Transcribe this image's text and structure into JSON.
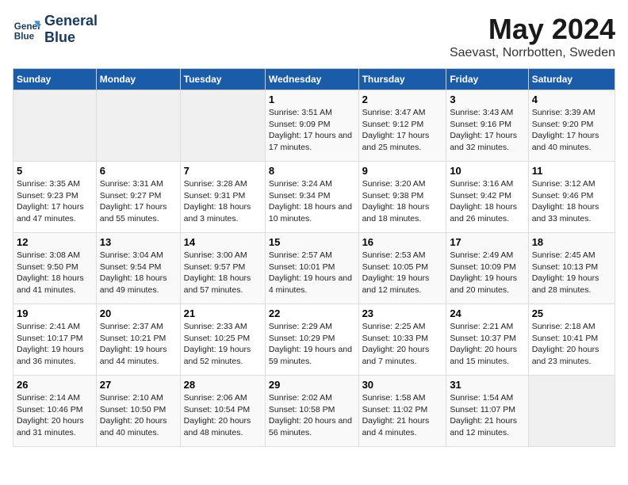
{
  "logo": {
    "line1": "General",
    "line2": "Blue"
  },
  "title": "May 2024",
  "subtitle": "Saevast, Norrbotten, Sweden",
  "days_header": [
    "Sunday",
    "Monday",
    "Tuesday",
    "Wednesday",
    "Thursday",
    "Friday",
    "Saturday"
  ],
  "weeks": [
    [
      {
        "num": "",
        "sunrise": "",
        "sunset": "",
        "daylight": ""
      },
      {
        "num": "",
        "sunrise": "",
        "sunset": "",
        "daylight": ""
      },
      {
        "num": "",
        "sunrise": "",
        "sunset": "",
        "daylight": ""
      },
      {
        "num": "1",
        "sunrise": "Sunrise: 3:51 AM",
        "sunset": "Sunset: 9:09 PM",
        "daylight": "Daylight: 17 hours and 17 minutes."
      },
      {
        "num": "2",
        "sunrise": "Sunrise: 3:47 AM",
        "sunset": "Sunset: 9:12 PM",
        "daylight": "Daylight: 17 hours and 25 minutes."
      },
      {
        "num": "3",
        "sunrise": "Sunrise: 3:43 AM",
        "sunset": "Sunset: 9:16 PM",
        "daylight": "Daylight: 17 hours and 32 minutes."
      },
      {
        "num": "4",
        "sunrise": "Sunrise: 3:39 AM",
        "sunset": "Sunset: 9:20 PM",
        "daylight": "Daylight: 17 hours and 40 minutes."
      }
    ],
    [
      {
        "num": "5",
        "sunrise": "Sunrise: 3:35 AM",
        "sunset": "Sunset: 9:23 PM",
        "daylight": "Daylight: 17 hours and 47 minutes."
      },
      {
        "num": "6",
        "sunrise": "Sunrise: 3:31 AM",
        "sunset": "Sunset: 9:27 PM",
        "daylight": "Daylight: 17 hours and 55 minutes."
      },
      {
        "num": "7",
        "sunrise": "Sunrise: 3:28 AM",
        "sunset": "Sunset: 9:31 PM",
        "daylight": "Daylight: 18 hours and 3 minutes."
      },
      {
        "num": "8",
        "sunrise": "Sunrise: 3:24 AM",
        "sunset": "Sunset: 9:34 PM",
        "daylight": "Daylight: 18 hours and 10 minutes."
      },
      {
        "num": "9",
        "sunrise": "Sunrise: 3:20 AM",
        "sunset": "Sunset: 9:38 PM",
        "daylight": "Daylight: 18 hours and 18 minutes."
      },
      {
        "num": "10",
        "sunrise": "Sunrise: 3:16 AM",
        "sunset": "Sunset: 9:42 PM",
        "daylight": "Daylight: 18 hours and 26 minutes."
      },
      {
        "num": "11",
        "sunrise": "Sunrise: 3:12 AM",
        "sunset": "Sunset: 9:46 PM",
        "daylight": "Daylight: 18 hours and 33 minutes."
      }
    ],
    [
      {
        "num": "12",
        "sunrise": "Sunrise: 3:08 AM",
        "sunset": "Sunset: 9:50 PM",
        "daylight": "Daylight: 18 hours and 41 minutes."
      },
      {
        "num": "13",
        "sunrise": "Sunrise: 3:04 AM",
        "sunset": "Sunset: 9:54 PM",
        "daylight": "Daylight: 18 hours and 49 minutes."
      },
      {
        "num": "14",
        "sunrise": "Sunrise: 3:00 AM",
        "sunset": "Sunset: 9:57 PM",
        "daylight": "Daylight: 18 hours and 57 minutes."
      },
      {
        "num": "15",
        "sunrise": "Sunrise: 2:57 AM",
        "sunset": "Sunset: 10:01 PM",
        "daylight": "Daylight: 19 hours and 4 minutes."
      },
      {
        "num": "16",
        "sunrise": "Sunrise: 2:53 AM",
        "sunset": "Sunset: 10:05 PM",
        "daylight": "Daylight: 19 hours and 12 minutes."
      },
      {
        "num": "17",
        "sunrise": "Sunrise: 2:49 AM",
        "sunset": "Sunset: 10:09 PM",
        "daylight": "Daylight: 19 hours and 20 minutes."
      },
      {
        "num": "18",
        "sunrise": "Sunrise: 2:45 AM",
        "sunset": "Sunset: 10:13 PM",
        "daylight": "Daylight: 19 hours and 28 minutes."
      }
    ],
    [
      {
        "num": "19",
        "sunrise": "Sunrise: 2:41 AM",
        "sunset": "Sunset: 10:17 PM",
        "daylight": "Daylight: 19 hours and 36 minutes."
      },
      {
        "num": "20",
        "sunrise": "Sunrise: 2:37 AM",
        "sunset": "Sunset: 10:21 PM",
        "daylight": "Daylight: 19 hours and 44 minutes."
      },
      {
        "num": "21",
        "sunrise": "Sunrise: 2:33 AM",
        "sunset": "Sunset: 10:25 PM",
        "daylight": "Daylight: 19 hours and 52 minutes."
      },
      {
        "num": "22",
        "sunrise": "Sunrise: 2:29 AM",
        "sunset": "Sunset: 10:29 PM",
        "daylight": "Daylight: 19 hours and 59 minutes."
      },
      {
        "num": "23",
        "sunrise": "Sunrise: 2:25 AM",
        "sunset": "Sunset: 10:33 PM",
        "daylight": "Daylight: 20 hours and 7 minutes."
      },
      {
        "num": "24",
        "sunrise": "Sunrise: 2:21 AM",
        "sunset": "Sunset: 10:37 PM",
        "daylight": "Daylight: 20 hours and 15 minutes."
      },
      {
        "num": "25",
        "sunrise": "Sunrise: 2:18 AM",
        "sunset": "Sunset: 10:41 PM",
        "daylight": "Daylight: 20 hours and 23 minutes."
      }
    ],
    [
      {
        "num": "26",
        "sunrise": "Sunrise: 2:14 AM",
        "sunset": "Sunset: 10:46 PM",
        "daylight": "Daylight: 20 hours and 31 minutes."
      },
      {
        "num": "27",
        "sunrise": "Sunrise: 2:10 AM",
        "sunset": "Sunset: 10:50 PM",
        "daylight": "Daylight: 20 hours and 40 minutes."
      },
      {
        "num": "28",
        "sunrise": "Sunrise: 2:06 AM",
        "sunset": "Sunset: 10:54 PM",
        "daylight": "Daylight: 20 hours and 48 minutes."
      },
      {
        "num": "29",
        "sunrise": "Sunrise: 2:02 AM",
        "sunset": "Sunset: 10:58 PM",
        "daylight": "Daylight: 20 hours and 56 minutes."
      },
      {
        "num": "30",
        "sunrise": "Sunrise: 1:58 AM",
        "sunset": "Sunset: 11:02 PM",
        "daylight": "Daylight: 21 hours and 4 minutes."
      },
      {
        "num": "31",
        "sunrise": "Sunrise: 1:54 AM",
        "sunset": "Sunset: 11:07 PM",
        "daylight": "Daylight: 21 hours and 12 minutes."
      },
      {
        "num": "",
        "sunrise": "",
        "sunset": "",
        "daylight": ""
      }
    ]
  ]
}
